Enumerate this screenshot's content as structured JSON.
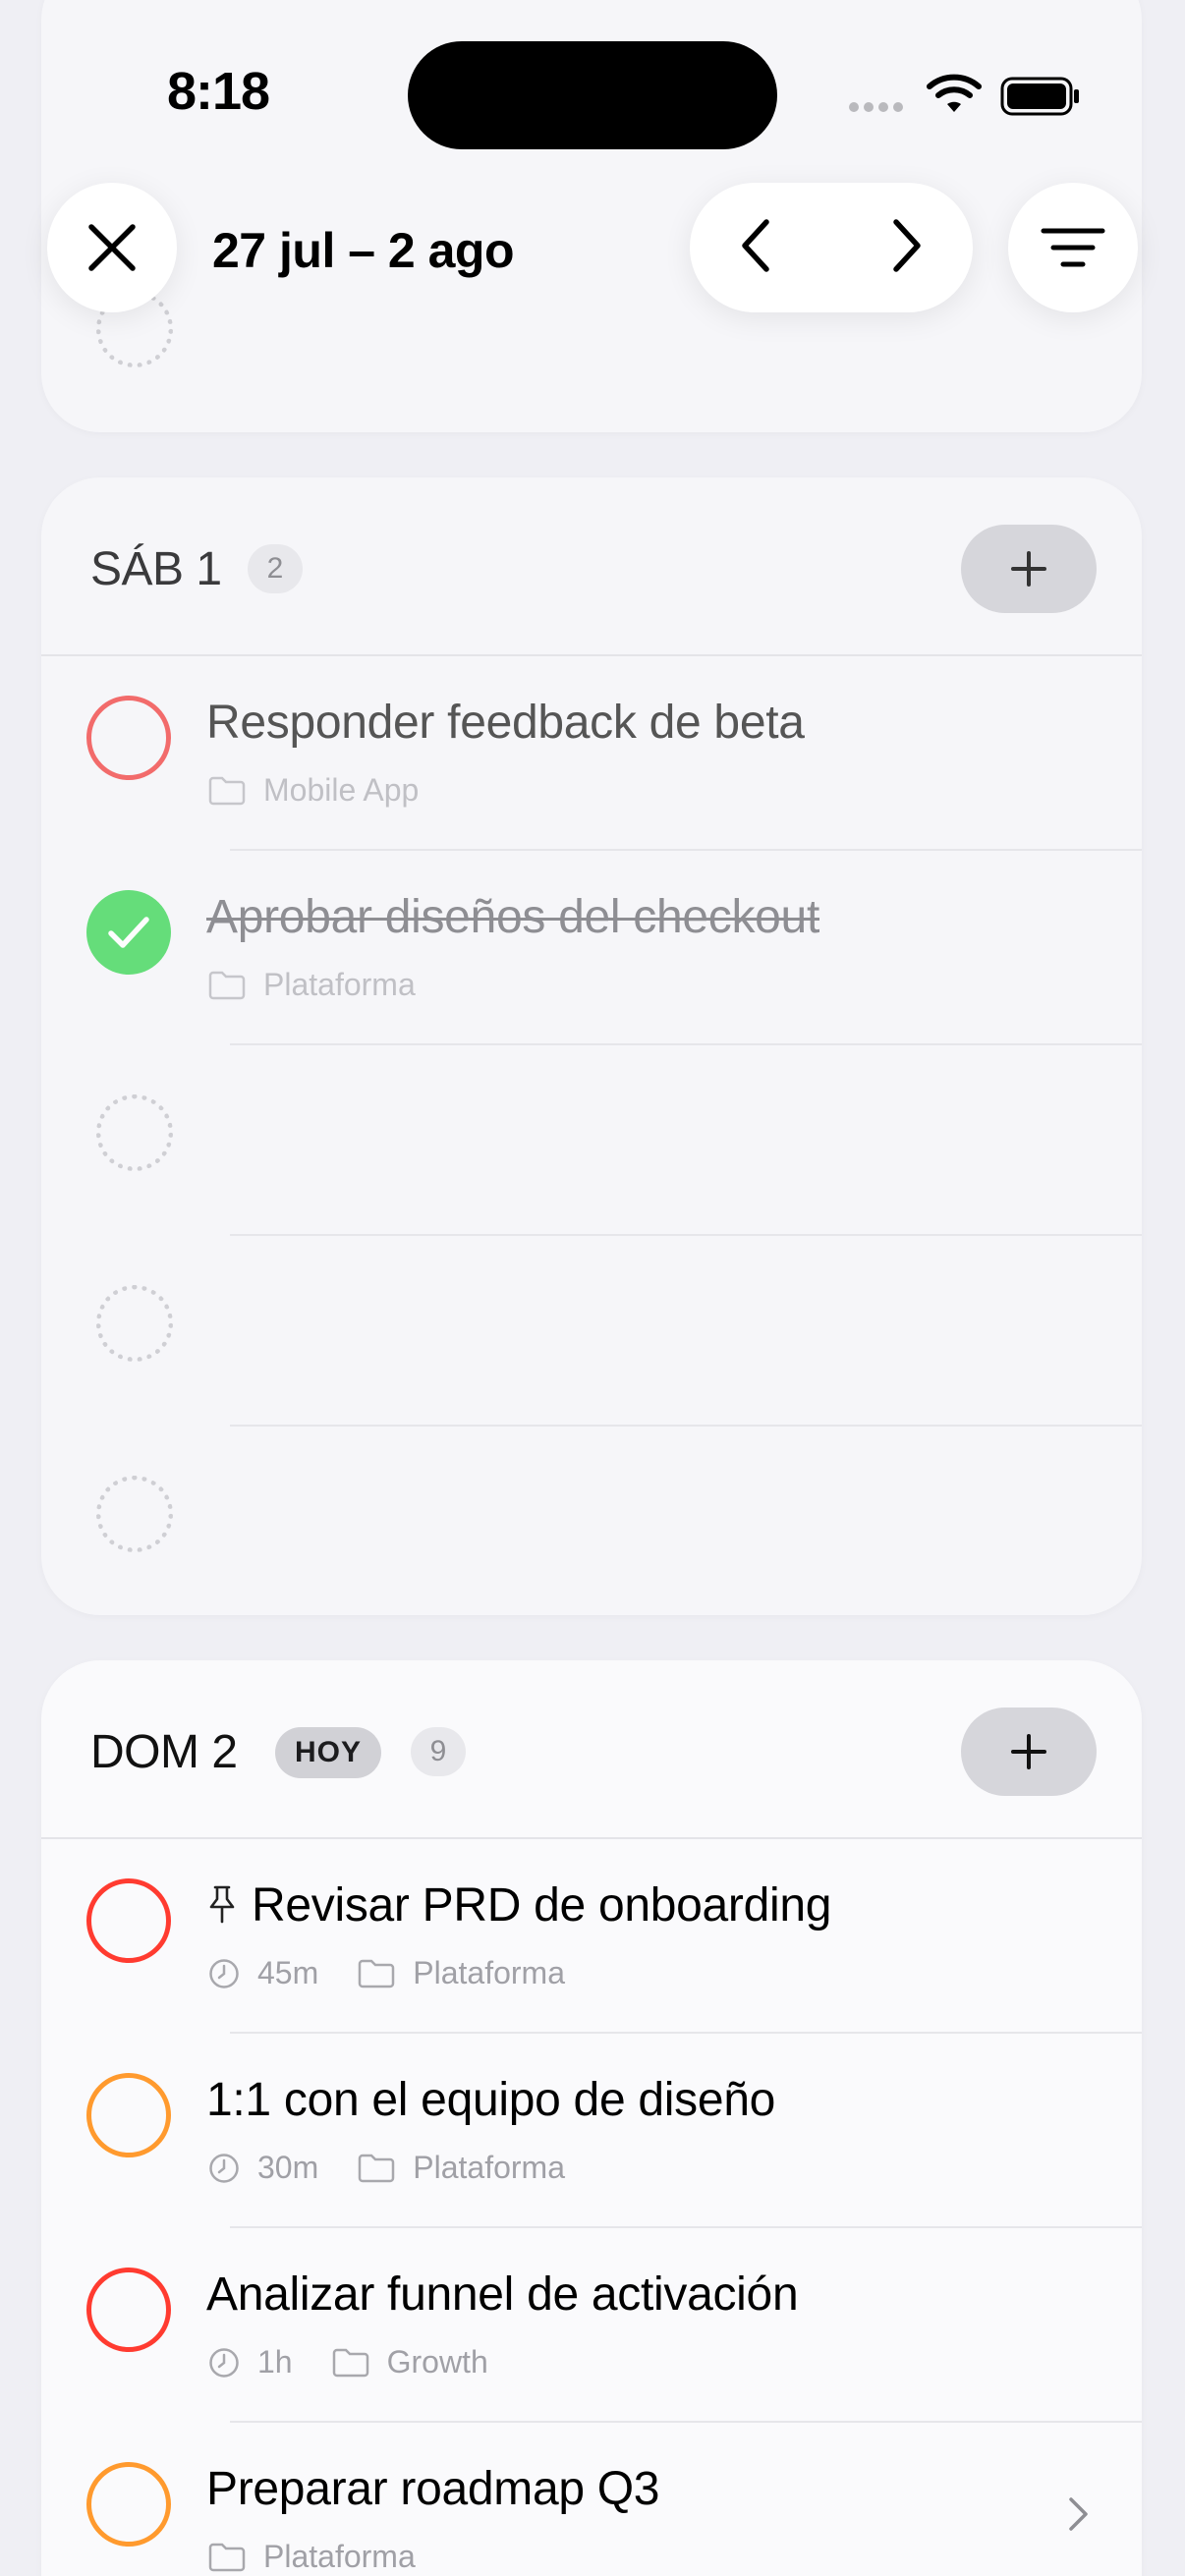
{
  "status_bar": {
    "time": "8:18"
  },
  "header": {
    "date_range": "27 jul – 2 ago"
  },
  "days": [
    {
      "label": "SÁB 1",
      "count": "2",
      "tasks": [
        {
          "title": "Responder feedback de beta",
          "project": "Mobile App",
          "status": "open",
          "color": "#f26b6b"
        },
        {
          "title": "Aprobar diseños del checkout",
          "project": "Plataforma",
          "status": "done",
          "color": "#4cd964"
        }
      ]
    },
    {
      "label": "DOM 2",
      "today_badge": "HOY",
      "count": "9",
      "tasks": [
        {
          "title": "Revisar PRD de onboarding",
          "pinned": true,
          "duration": "45m",
          "project": "Plataforma",
          "color": "#ff3b30"
        },
        {
          "title": "1:1 con el equipo de diseño",
          "duration": "30m",
          "project": "Plataforma",
          "color": "#ff9a2e"
        },
        {
          "title": "Analizar funnel de activación",
          "duration": "1h",
          "project": "Growth",
          "color": "#ff3b30"
        },
        {
          "title": "Preparar roadmap Q3",
          "project": "Plataforma",
          "color": "#ff9a2e"
        }
      ]
    }
  ],
  "icons": {
    "close": "close-icon",
    "prev": "chevron-left-icon",
    "next": "chevron-right-icon",
    "filter": "filter-icon",
    "add": "plus-icon",
    "folder": "folder-icon",
    "clock": "clock-icon",
    "pin": "pin-icon"
  }
}
